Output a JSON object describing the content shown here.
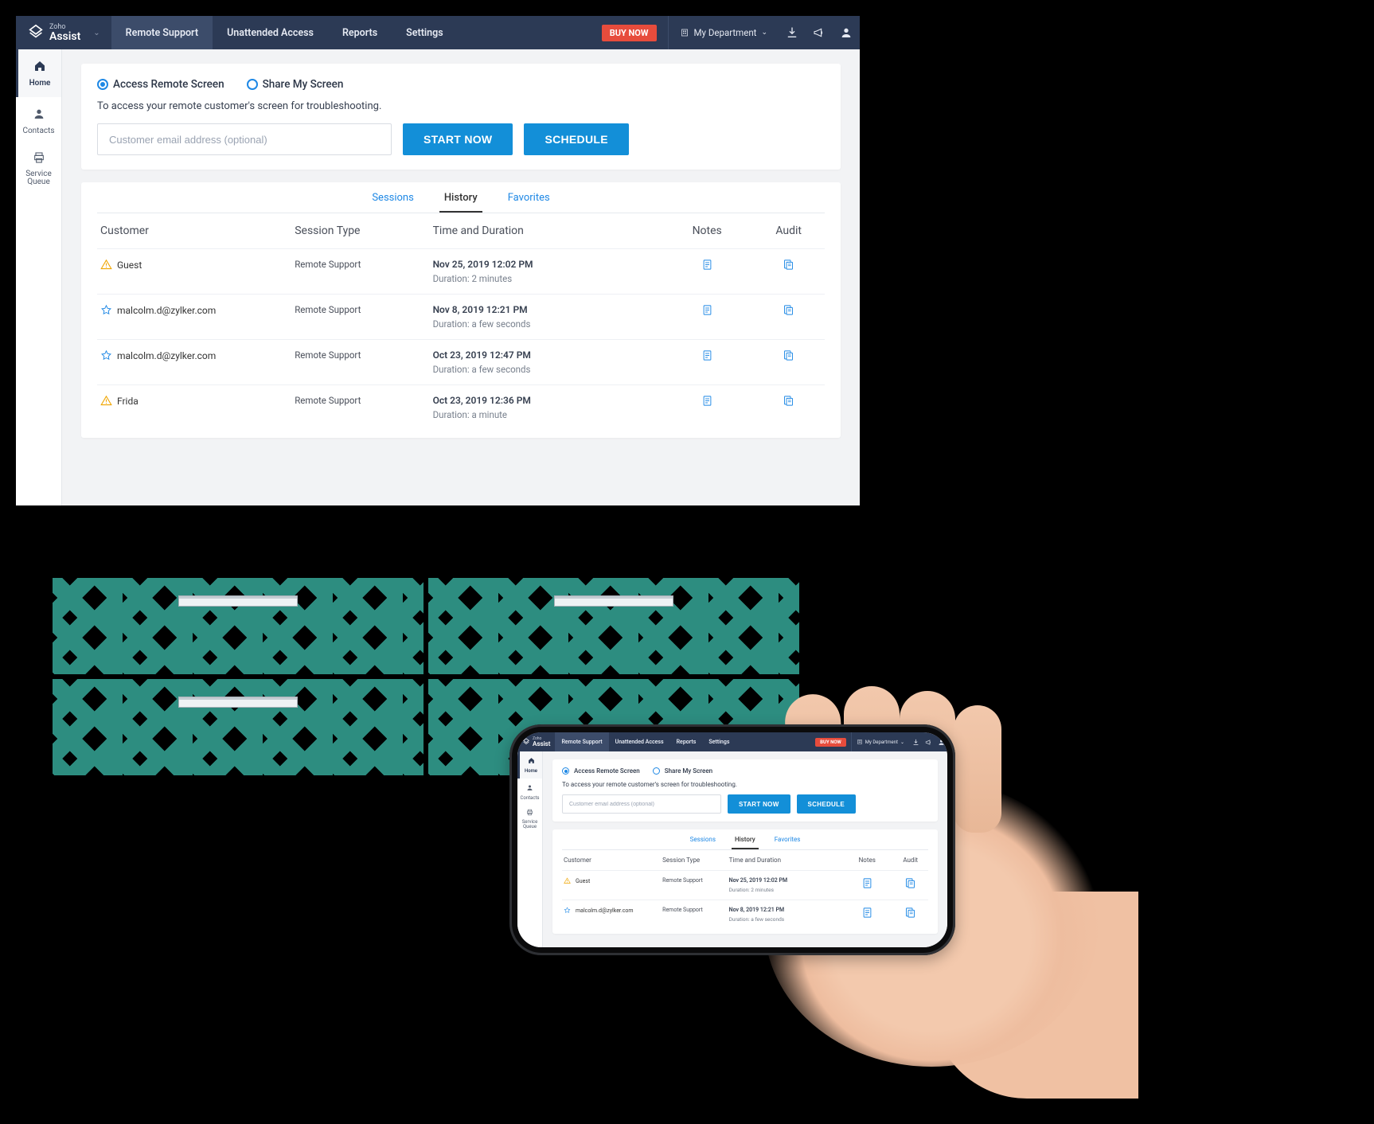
{
  "brand": {
    "top": "Zoho",
    "name": "Assist"
  },
  "nav": {
    "remote_support": "Remote Support",
    "unattended": "Unattended Access",
    "reports": "Reports",
    "settings": "Settings"
  },
  "buy_now": "BUY NOW",
  "department_label": "My Department",
  "sidebar": {
    "home": "Home",
    "contacts": "Contacts",
    "service_queue_1": "Service",
    "service_queue_2": "Queue"
  },
  "mode": {
    "access": "Access Remote Screen",
    "share": "Share My Screen"
  },
  "hint": "To access your remote customer's screen for troubleshooting.",
  "email_placeholder": "Customer email address (optional)",
  "buttons": {
    "start": "START NOW",
    "schedule": "SCHEDULE"
  },
  "tabs": {
    "sessions": "Sessions",
    "history": "History",
    "favorites": "Favorites"
  },
  "columns": {
    "customer": "Customer",
    "session_type": "Session Type",
    "time": "Time and Duration",
    "notes": "Notes",
    "audit": "Audit"
  },
  "rows": [
    {
      "icon": "warn",
      "customer": "Guest",
      "type": "Remote Support",
      "time": "Nov 25, 2019 12:02 PM",
      "duration": "Duration: 2 minutes"
    },
    {
      "icon": "star",
      "customer": "malcolm.d@zylker.com",
      "type": "Remote Support",
      "time": "Nov 8, 2019 12:21 PM",
      "duration": "Duration: a few seconds"
    },
    {
      "icon": "star",
      "customer": "malcolm.d@zylker.com",
      "type": "Remote Support",
      "time": "Oct 23, 2019 12:47 PM",
      "duration": "Duration: a few seconds"
    },
    {
      "icon": "warn",
      "customer": "Frida",
      "type": "Remote Support",
      "time": "Oct 23, 2019 12:36 PM",
      "duration": "Duration: a minute"
    }
  ],
  "phone_rows": [
    {
      "icon": "warn",
      "customer": "Guest",
      "type": "Remote Support",
      "time": "Nov 25, 2019 12:02 PM",
      "duration": "Duration: 2 minutes"
    },
    {
      "icon": "star",
      "customer": "malcolm.d@zylker.com",
      "type": "Remote Support",
      "time": "Nov 8, 2019 12:21 PM",
      "duration": "Duration: a few seconds"
    }
  ]
}
